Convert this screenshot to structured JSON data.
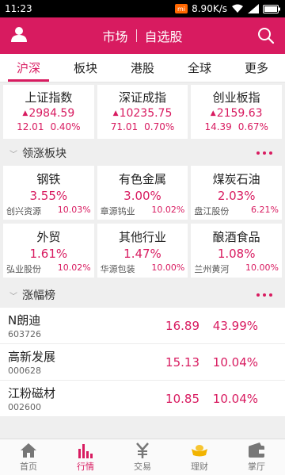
{
  "status_bar": {
    "time": "11:23",
    "speed": "8.90K/s"
  },
  "header": {
    "title_market": "市场",
    "title_watchlist": "自选股"
  },
  "tabs": [
    {
      "label": "沪深",
      "active": true
    },
    {
      "label": "板块",
      "active": false
    },
    {
      "label": "港股",
      "active": false
    },
    {
      "label": "全球",
      "active": false
    },
    {
      "label": "更多",
      "active": false
    }
  ],
  "indices": [
    {
      "name": "上证指数",
      "value": "2984.59",
      "change": "12.01",
      "percent": "0.40%"
    },
    {
      "name": "深证成指",
      "value": "10235.75",
      "change": "71.01",
      "percent": "0.70%"
    },
    {
      "name": "创业板指",
      "value": "2159.63",
      "change": "14.39",
      "percent": "0.67%"
    }
  ],
  "sectors_section": {
    "title": "领涨板块",
    "items": [
      {
        "name": "钢铁",
        "percent": "3.55%",
        "lead_stock": "创兴资源",
        "lead_percent": "10.03%"
      },
      {
        "name": "有色金属",
        "percent": "3.00%",
        "lead_stock": "章源钨业",
        "lead_percent": "10.02%"
      },
      {
        "name": "煤炭石油",
        "percent": "2.03%",
        "lead_stock": "盘江股份",
        "lead_percent": "6.21%"
      },
      {
        "name": "外贸",
        "percent": "1.61%",
        "lead_stock": "弘业股份",
        "lead_percent": "10.02%"
      },
      {
        "name": "其他行业",
        "percent": "1.47%",
        "lead_stock": "华源包装",
        "lead_percent": "10.00%"
      },
      {
        "name": "酿酒食品",
        "percent": "1.08%",
        "lead_stock": "兰州黄河",
        "lead_percent": "10.00%"
      }
    ]
  },
  "gainers_section": {
    "title": "涨幅榜",
    "rows": [
      {
        "name": "N朗迪",
        "code": "603726",
        "price": "16.89",
        "percent": "43.99%"
      },
      {
        "name": "高新发展",
        "code": "000628",
        "price": "15.13",
        "percent": "10.04%"
      },
      {
        "name": "江粉磁材",
        "code": "002600",
        "price": "10.85",
        "percent": "10.04%"
      }
    ]
  },
  "bottom_nav": [
    {
      "label": "首页",
      "icon": "home-icon",
      "active": false
    },
    {
      "label": "行情",
      "icon": "market-chart-icon",
      "active": true
    },
    {
      "label": "交易",
      "icon": "yen-icon",
      "active": false
    },
    {
      "label": "理财",
      "icon": "gold-ingot-icon",
      "active": false
    },
    {
      "label": "掌厅",
      "icon": "wallet-icon",
      "active": false
    }
  ],
  "colors": {
    "accent": "#d81b60",
    "background": "#efefef"
  }
}
